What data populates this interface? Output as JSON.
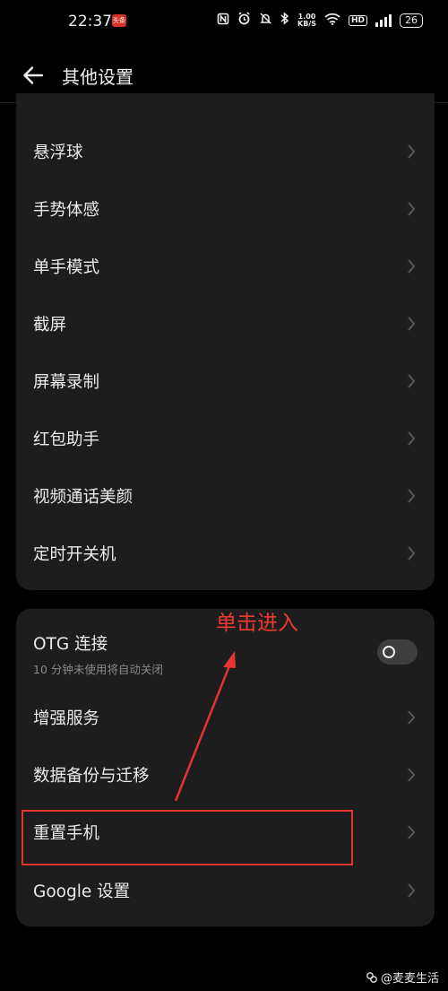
{
  "status_bar": {
    "time": "22:37",
    "news_badge": "头条",
    "net_speed_value": "1.00",
    "net_speed_unit": "KB/S",
    "hd_label": "HD",
    "battery": "26",
    "icons": [
      "nfc-icon",
      "alarm-icon",
      "mute-icon",
      "bluetooth-icon",
      "wifi-icon",
      "signal-icon",
      "battery-icon"
    ]
  },
  "header": {
    "title": "其他设置"
  },
  "card1": {
    "items": [
      {
        "label": "悬浮球"
      },
      {
        "label": "手势体感"
      },
      {
        "label": "单手模式"
      },
      {
        "label": "截屏"
      },
      {
        "label": "屏幕录制"
      },
      {
        "label": "红包助手"
      },
      {
        "label": "视频通话美颜"
      },
      {
        "label": "定时开关机"
      }
    ]
  },
  "card2": {
    "otg": {
      "label": "OTG 连接",
      "sub": "10 分钟未使用将自动关闭",
      "toggle_on": false
    },
    "items": [
      {
        "label": "增强服务"
      },
      {
        "label": "数据备份与迁移"
      },
      {
        "label": "重置手机"
      },
      {
        "label": "Google 设置"
      }
    ]
  },
  "annotation": {
    "text": "单击进入",
    "color": "#ee3b30"
  },
  "watermark": {
    "text": "@麦麦生活"
  },
  "colors": {
    "background": "#000000",
    "card": "#1d1d1d",
    "text": "#eaeaea",
    "annotation": "#e53434"
  }
}
